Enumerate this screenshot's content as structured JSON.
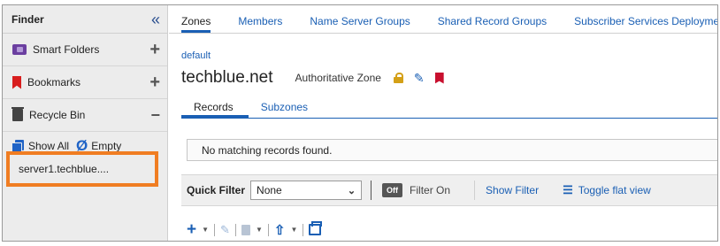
{
  "sidebar": {
    "title": "Finder",
    "collapse_glyph": "«",
    "items": [
      {
        "label": "Smart Folders",
        "icon": "smart-folder-icon",
        "action": "+"
      },
      {
        "label": "Bookmarks",
        "icon": "bookmark-icon",
        "action": "+"
      },
      {
        "label": "Recycle Bin",
        "icon": "recycle-bin-icon",
        "action": "−"
      }
    ],
    "show_all": "Show All",
    "empty": "Empty",
    "empty_glyph": "Ø",
    "server_item": "server1.techblue...."
  },
  "top_tabs": [
    "Zones",
    "Members",
    "Name Server Groups",
    "Shared Record Groups",
    "Subscriber Services Deployment"
  ],
  "breadcrumb": "default",
  "zone": {
    "name": "techblue.net",
    "type": "Authoritative Zone"
  },
  "sub_tabs": [
    "Records",
    "Subzones"
  ],
  "message": "No matching records found.",
  "filter_bar": {
    "label": "Quick Filter",
    "selected": "None",
    "toggle": "Off",
    "filter_on": "Filter On",
    "show_filter": "Show Filter",
    "toggle_flat": "Toggle flat view"
  },
  "colors": {
    "accent": "#1a5fb4",
    "highlight_border": "#f07d22",
    "lock": "#d4a017",
    "bookmark": "#d81e1e"
  }
}
